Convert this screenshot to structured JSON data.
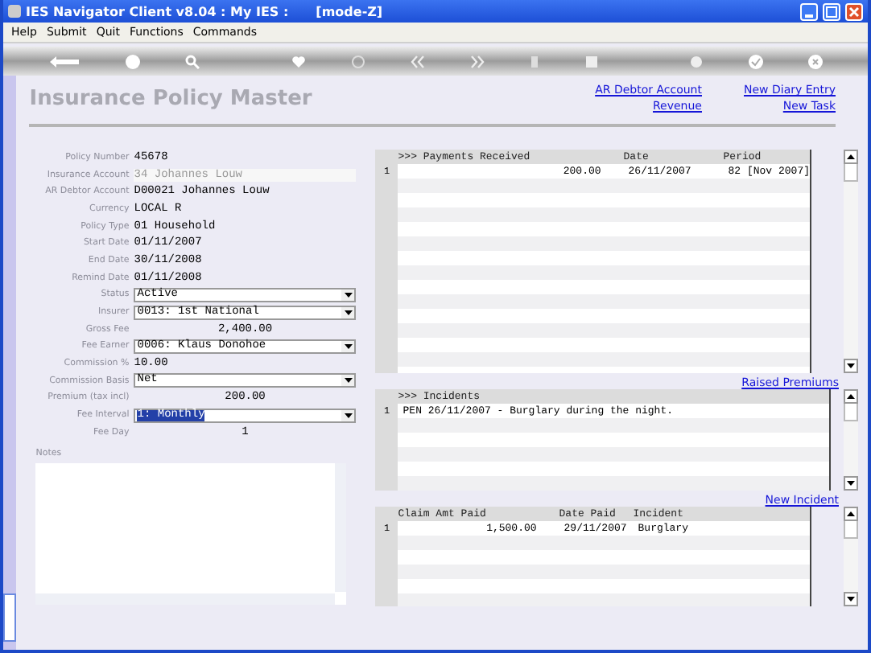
{
  "window": {
    "title": "IES Navigator Client v8.04 : My IES :",
    "mode": "[mode-Z]"
  },
  "menu": [
    "Help",
    "Submit",
    "Quit",
    "Functions",
    "Commands"
  ],
  "page_title": "Insurance Policy Master",
  "links_top": [
    {
      "label": "AR Debtor Account"
    },
    {
      "label": "New Diary Entry"
    },
    {
      "label": "Revenue"
    },
    {
      "label": "New Task"
    }
  ],
  "form": [
    {
      "label": "Policy Number",
      "value": "45678",
      "kind": "text",
      "dimmed": false,
      "highlighted": false
    },
    {
      "label": "Insurance Account",
      "value": "34 Johannes Louw",
      "kind": "text",
      "dimmed": true,
      "highlighted": false
    },
    {
      "label": "AR Debtor Account",
      "value": "D00021 Johannes Louw",
      "kind": "text",
      "dimmed": false,
      "highlighted": false
    },
    {
      "label": "Currency",
      "value": "LOCAL R",
      "kind": "text",
      "dimmed": false,
      "highlighted": false
    },
    {
      "label": "Policy Type",
      "value": "01 Household",
      "kind": "text",
      "dimmed": false,
      "highlighted": false
    },
    {
      "label": "Start Date",
      "value": "01/11/2007",
      "kind": "text",
      "dimmed": false,
      "highlighted": false
    },
    {
      "label": "End Date",
      "value": "30/11/2008",
      "kind": "text",
      "dimmed": false,
      "highlighted": false
    },
    {
      "label": "Remind Date",
      "value": "01/11/2008",
      "kind": "text",
      "dimmed": false,
      "highlighted": false
    },
    {
      "label": "Status",
      "value": "Active",
      "kind": "dropdown",
      "dimmed": false,
      "highlighted": false
    },
    {
      "label": "Insurer",
      "value": "0013: 1st National",
      "kind": "dropdown",
      "dimmed": false,
      "highlighted": false
    },
    {
      "label": "Gross Fee",
      "value": "2,400.00",
      "kind": "amount",
      "dimmed": false,
      "highlighted": false
    },
    {
      "label": "Fee Earner",
      "value": "0006: Klaus Donohoe",
      "kind": "dropdown",
      "dimmed": false,
      "highlighted": false
    },
    {
      "label": "Commission %",
      "value": "10.00",
      "kind": "text",
      "dimmed": false,
      "highlighted": false
    },
    {
      "label": "Commission Basis",
      "value": "Net",
      "kind": "dropdown",
      "dimmed": false,
      "highlighted": false
    },
    {
      "label": "Premium (tax incl)",
      "value": "200.00",
      "kind": "amount",
      "dimmed": false,
      "highlighted": false
    },
    {
      "label": "Fee Interval",
      "value": "1: Monthly",
      "kind": "dropdown",
      "dimmed": false,
      "highlighted": true
    },
    {
      "label": "Fee Day",
      "value": "1",
      "kind": "amount",
      "dimmed": false,
      "highlighted": false
    }
  ],
  "notes": {
    "label": "Notes"
  },
  "payments": {
    "columns": [
      ">>> Payments Received",
      "Date",
      "Period"
    ],
    "rows": [
      {
        "index": "1",
        "cells": [
          "200.00",
          "26/11/2007",
          "82  [Nov 2007]"
        ]
      }
    ]
  },
  "link_raised": {
    "label": "Raised Premiums"
  },
  "incidents": {
    "columns": [
      ">>> Incidents"
    ],
    "rows": [
      {
        "index": "1",
        "cells": [
          "PEN 26/11/2007 - Burglary during the night."
        ]
      }
    ]
  },
  "link_incident": {
    "label": "New Incident"
  },
  "claims": {
    "columns": [
      "Claim Amt Paid",
      "Date Paid",
      "Incident"
    ],
    "rows": [
      {
        "index": "1",
        "cells": [
          "1,500.00",
          "29/11/2007",
          "Burglary"
        ]
      }
    ]
  }
}
